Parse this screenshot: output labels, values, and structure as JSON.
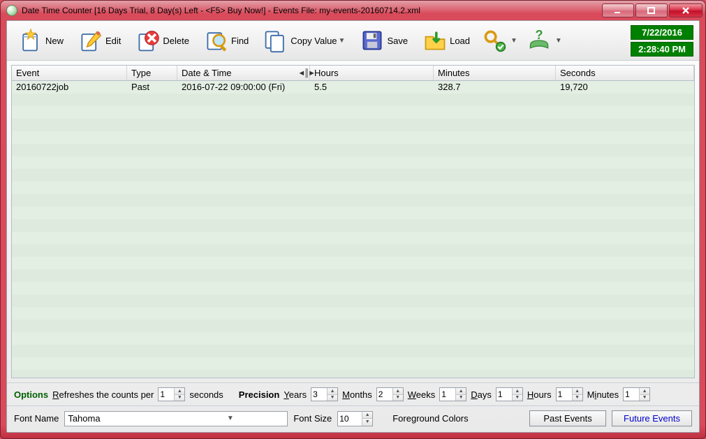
{
  "window": {
    "title": "Date Time Counter [16 Days Trial, 8 Day(s) Left  - <F5> Buy Now!] - Events File: my-events-20160714.2.xml"
  },
  "toolbar": {
    "new": "New",
    "edit": "Edit",
    "delete": "Delete",
    "find": "Find",
    "copy": "Copy Value",
    "save": "Save",
    "load": "Load"
  },
  "clock": {
    "date": "7/22/2016",
    "time": "2:28:40 PM"
  },
  "columns": [
    "Event",
    "Type",
    "Date & Time",
    "Hours",
    "Minutes",
    "Seconds"
  ],
  "rows": [
    {
      "event": "20160722job",
      "type": "Past",
      "datetime": "2016-07-22 09:00:00 (Fri)",
      "hours": "5.5",
      "minutes": "328.7",
      "seconds": "19,720"
    }
  ],
  "options": {
    "header": "Options",
    "refresh_pre": "Refreshes the counts per",
    "refresh_val": "1",
    "refresh_post": "seconds",
    "precision": "Precision",
    "years_lbl": "Years",
    "years_val": "3",
    "months_lbl": "Months",
    "months_val": "2",
    "weeks_lbl": "Weeks",
    "weeks_val": "1",
    "days_lbl": "Days",
    "days_val": "1",
    "hours_lbl": "Hours",
    "hours_val": "1",
    "minutes_lbl": "Minutes",
    "minutes_val": "1"
  },
  "bottom": {
    "font_name_lbl": "Font Name",
    "font_name_val": "Tahoma",
    "font_size_lbl": "Font Size",
    "font_size_val": "10",
    "fg_colors": "Foreground Colors",
    "past_btn": "Past Events",
    "future_btn": "Future Events"
  }
}
